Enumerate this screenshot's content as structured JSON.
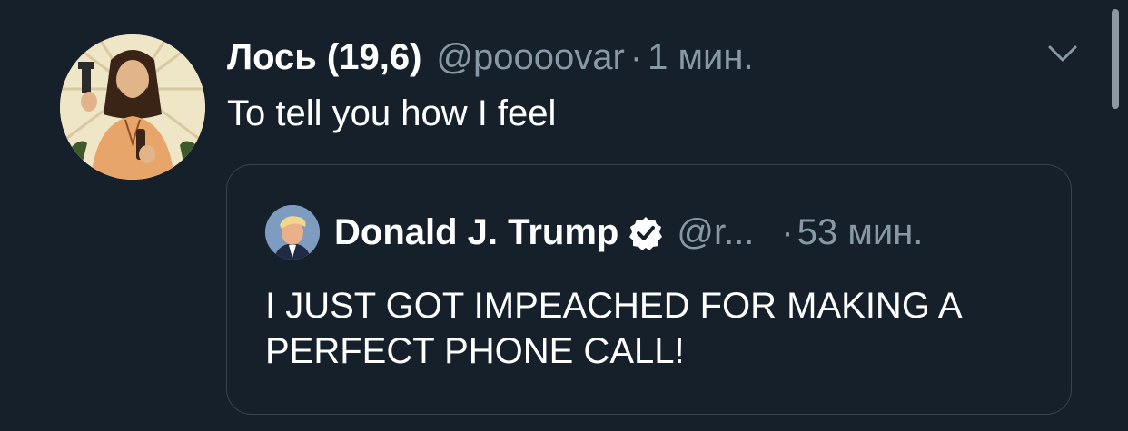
{
  "tweet": {
    "display_name": "Лось (19,6)",
    "handle": "@poooovar",
    "separator": "·",
    "time": "1 мин.",
    "text": "To tell you how I feel",
    "menu_icon": "chevron-down-icon",
    "avatar_icon": "avatar-image"
  },
  "quoted_tweet": {
    "display_name": "Donald J. Trump",
    "verified_icon": "verified-badge-icon",
    "handle": "@r...",
    "separator": "·",
    "time": "53 мин.",
    "text": "I JUST GOT IMPEACHED FOR MAKING A PERFECT PHONE CALL!"
  },
  "colors": {
    "background": "#15202b",
    "primary_text": "#ffffff",
    "secondary_text": "#8899a6",
    "border": "#38444d"
  }
}
